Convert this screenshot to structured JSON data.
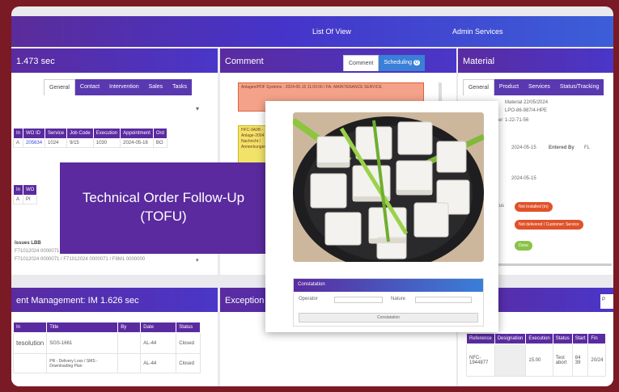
{
  "topbar": {
    "left_text": "List Of View",
    "right_text": "Admin Services"
  },
  "left_panel": {
    "title": "1.473 sec",
    "tabs": [
      "General",
      "Contact",
      "Intervention",
      "Sales",
      "Tasks"
    ],
    "table1": {
      "headers": [
        "In",
        "WO ID",
        "Service",
        "Job Code",
        "Execution",
        "Appointment",
        "Ord"
      ],
      "rows": [
        [
          "A",
          "205634",
          "1024",
          "9/15",
          "1030",
          "2024-05-16",
          "BO"
        ]
      ]
    },
    "table2": {
      "headers": [
        "In",
        "WO"
      ],
      "rows": [
        [
          "A",
          "PI"
        ]
      ]
    },
    "footer_label": "Issues LBB",
    "footer_line1": "F71012024 0000071 / F71012024 0000071 / F8M1 0000000",
    "footer_line2": "F71012024 0000071 / F71012024 0000071 / F8M1 0000000"
  },
  "tofu_banner": {
    "line1": "Technical Order Follow-Up",
    "line2": "(TOFU)"
  },
  "comment_panel": {
    "title": "Comment",
    "tabs": [
      "Comment",
      "Scheduling"
    ],
    "tab_badge": "0",
    "comments": [
      "Anlagen/PDF Systems - 2024-05-15 11:00:00 / FA- MAINTENANCE SERVICE",
      "HFC-9A9B - Anlage-2004 / Nachricht / Anmerkungen"
    ]
  },
  "popup": {
    "form_title": "Constatation",
    "field1_label": "Operator",
    "field2_label": "Nature",
    "submit_label": "Constatation"
  },
  "material_panel": {
    "title": "Material",
    "tabs": [
      "General",
      "Product",
      "Services",
      "Status/Tracking"
    ],
    "fields": [
      {
        "label": "",
        "value": "Material 22/05/2024"
      },
      {
        "label": "",
        "value": "LPO-86-987/4-HPE"
      },
      {
        "label": "Order",
        "value": "1-22-71-56"
      },
      {
        "label": "ate",
        "value": "2024-05-15",
        "extra_label": "Entered By",
        "extra_value": "FL"
      },
      {
        "label": "ate",
        "value": "2024-05-15"
      },
      {
        "label": "Status",
        "value": "Not Installed (In)"
      },
      {
        "label": "ype",
        "value": "Not delivered / Customer: Service"
      }
    ],
    "ok_badge": "Done"
  },
  "incident_panel": {
    "title": "ent Management: IM 1.626 sec",
    "headers": [
      "In",
      "Title",
      "By",
      "Date",
      "Status"
    ],
    "rows": [
      [
        "A",
        "tesolution",
        "SGS-1661",
        "",
        "AL-44",
        "Closed"
      ],
      [
        "",
        "",
        "PR - Delivery Loss / SMS - Downloading Plan",
        "",
        "AL-44",
        "Closed"
      ]
    ]
  },
  "exception_panel": {
    "title": "Exception"
  },
  "right_bottom_panel": {
    "headers": [
      "Reference",
      "Designation",
      "Execution",
      "Status",
      "Start",
      "Fin"
    ],
    "rows": [
      [
        "NFC-1944877",
        "",
        "15.00",
        "Test abort",
        "84 39",
        "20/24"
      ]
    ]
  },
  "colors": {
    "brand_purple": "#5a2ba0",
    "accent_blue": "#3a7fd8",
    "frame": "#7a1a24",
    "pill_red": "#e0522a",
    "pill_green": "#8bc34a"
  }
}
